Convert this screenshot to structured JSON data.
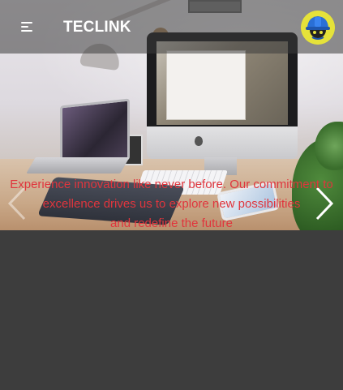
{
  "header": {
    "brand": "TECLINK",
    "menu_icon": "hamburger-menu-icon",
    "avatar_icon": "hardhat-avatar-icon"
  },
  "hero": {
    "image": "desk-workspace-photo",
    "caption_lines": [
      "Experience innovation like never before. Our commitment to",
      "excellence drives us to explore new possibilities",
      "and redefine the future"
    ],
    "prev_icon": "chevron-left-icon",
    "next_icon": "chevron-right-icon"
  },
  "colors": {
    "caption": "#e0353d",
    "page_background": "#3d3d3d",
    "header_overlay": "rgba(60,60,60,0.55)",
    "avatar_background": "#e5e23a"
  }
}
